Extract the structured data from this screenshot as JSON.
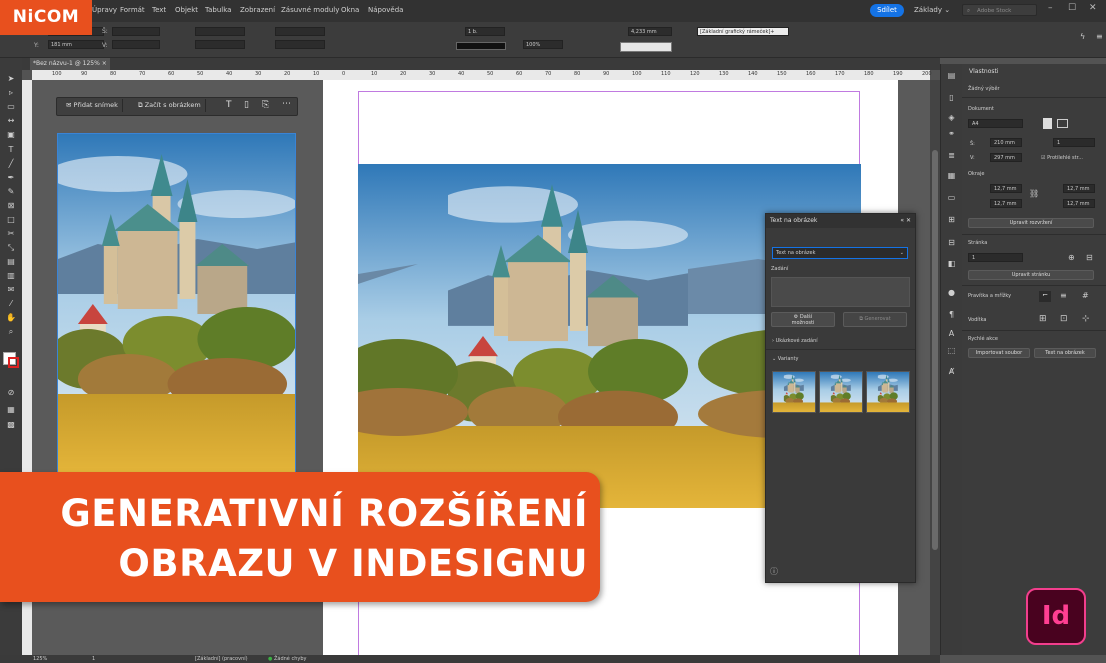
{
  "app": {
    "logo_text": "NiCOM",
    "menus": [
      "Úpravy",
      "Formát",
      "Text",
      "Objekt",
      "Tabulka",
      "Zobrazení",
      "Zásuvné moduly",
      "Okna",
      "Nápověda"
    ],
    "share_label": "Sdílet",
    "workspace_label": "Základy",
    "stock_placeholder": "Adobe Stock",
    "accent_color": "#e8501e",
    "share_color": "#1473e6"
  },
  "control_panel": {
    "x_label": "X:",
    "y_label": "Y:",
    "y_value": "181 mm",
    "w_label": "Š:",
    "h_label": "V:",
    "stroke_weight": "1 b.",
    "zoom_value": "100%",
    "dimension_value": "4,233 mm",
    "frame_style": "[Základní grafický rámeček]+"
  },
  "document": {
    "tab_title": "*Bez názvu-1 @ 125%",
    "ruler_ticks": [
      "100",
      "90",
      "80",
      "70",
      "60",
      "50",
      "40",
      "30",
      "20",
      "10",
      "0",
      "10",
      "20",
      "30",
      "40",
      "50",
      "60",
      "70",
      "80",
      "90",
      "100",
      "110",
      "120",
      "130",
      "140",
      "150",
      "160",
      "170",
      "180",
      "190",
      "200"
    ]
  },
  "context_bar": {
    "add_slide": "Přidat snímek",
    "start_with_image": "Začít s obrázkem"
  },
  "properties": {
    "panel_title": "Vlastnosti",
    "no_selection": "Žádný výběr",
    "document_heading": "Dokument",
    "page_size": "A4",
    "width_label": "Š:",
    "width_value": "210 mm",
    "height_label": "V:",
    "height_value": "297 mm",
    "pages_value": "1",
    "facing_pages": "Protilehlé str...",
    "margins_heading": "Okraje",
    "margin_top": "12,7 mm",
    "margin_bottom": "12,7 mm",
    "margin_left": "12,7 mm",
    "margin_right": "12,7 mm",
    "adjust_layout": "Upravit rozvržení",
    "page_heading": "Stránka",
    "page_value": "1",
    "edit_page": "Upravit stránku",
    "rulers_heading": "Pravítka a mřížky",
    "guides_heading": "Vodítka",
    "quick_actions": "Rychlé akce",
    "import_file": "Importovat soubor",
    "text_to_image": "Text na obrázek"
  },
  "tti_panel": {
    "title": "Text na obrázek",
    "select_value": "Text na obrázek",
    "prompt_label": "Zadání",
    "more_options": "Další\nmožnosti",
    "generate": "Generovat",
    "sample_prompts": "Ukázkové zadání",
    "variations": "Varianty"
  },
  "status_bar": {
    "zoom": "125%",
    "page": "1",
    "profile": "[Základní] (pracovní)",
    "errors": "Žádné chyby"
  },
  "banner": {
    "line1": "GENERATIVNÍ ROZŠÍŘENÍ",
    "line2": "OBRAZU V INDESIGNU"
  },
  "id_logo": "Id"
}
